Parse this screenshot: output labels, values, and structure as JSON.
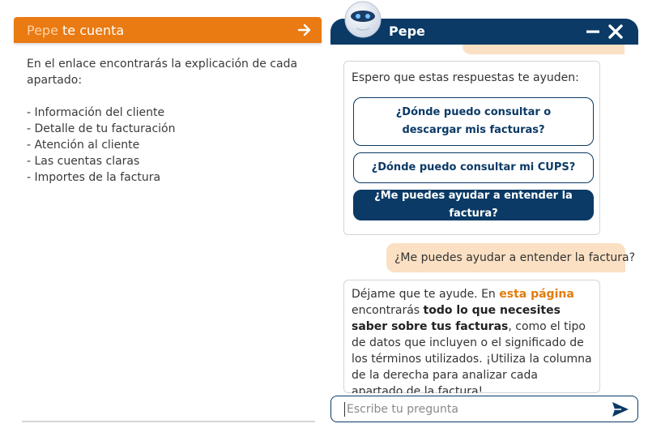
{
  "left_panel": {
    "header_brand": "Pepe",
    "header_title_rest": "te cuenta",
    "intro_line1": "En el enlace encontrarás la explicación de cada",
    "intro_line2": "apartado:",
    "items": [
      "- Información del cliente",
      "- Detalle de tu facturación",
      "- Atención al cliente",
      "- Las cuentas claras",
      "- Importes de la factura"
    ]
  },
  "chat": {
    "bot_name": "Pepe",
    "bot_intro": "Espero que estas respuestas te ayuden:",
    "suggestions": [
      "¿Dónde puedo consultar o descargar mis facturas?",
      "¿Dónde puedo consultar mi CUPS?",
      "¿Me puedes ayudar a entender la factura?"
    ],
    "user_message": "¿Me puedes ayudar a entender la factura?",
    "bot_reply": {
      "p1": "Déjame que te ayude. En ",
      "link": "esta página",
      "p2": " encontrarás ",
      "bold": "todo lo que necesites saber sobre tus facturas",
      "p3": ", como el tipo de datos que incluyen o el significado de los términos utilizados. ¡Utiliza la columna de la derecha para analizar cada apartado de la factura!"
    },
    "input_placeholder": "Escribe tu pregunta"
  },
  "colors": {
    "brand_orange": "#ea7a12",
    "navy": "#0b3a66",
    "user_bubble": "#fbe0c3",
    "link_orange": "#e37c0c"
  },
  "icons": {
    "arrow": "arrow-right-icon",
    "minimize": "minimize-icon",
    "close": "close-icon",
    "send": "send-icon",
    "avatar": "robot-avatar-icon"
  }
}
